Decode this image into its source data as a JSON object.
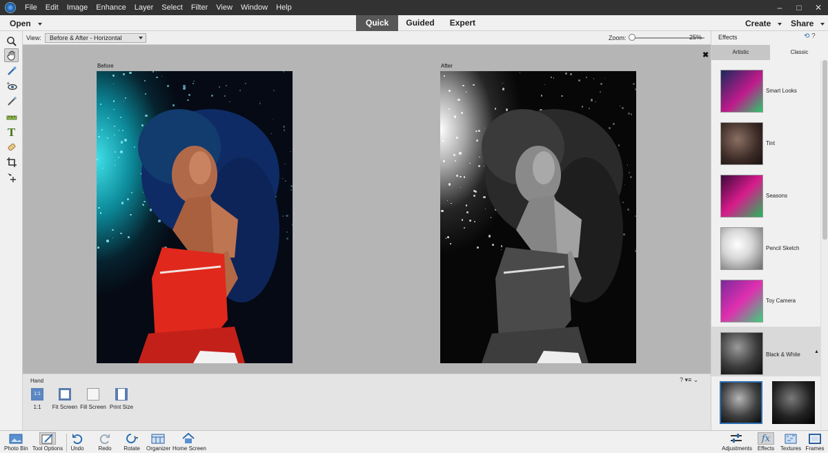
{
  "menubar": {
    "items": [
      "File",
      "Edit",
      "Image",
      "Enhance",
      "Layer",
      "Select",
      "Filter",
      "View",
      "Window",
      "Help"
    ],
    "window_controls": [
      "–",
      "□",
      "✕"
    ]
  },
  "modebar": {
    "open_label": "Open",
    "modes": [
      "Quick",
      "Guided",
      "Expert"
    ],
    "active_mode": "Quick",
    "create_label": "Create",
    "share_label": "Share"
  },
  "options": {
    "view_label": "View:",
    "view_value": "Before & After - Horizontal",
    "zoom_label": "Zoom:",
    "zoom_value": "25%",
    "zoom_fraction": 0.0
  },
  "canvas": {
    "before_label": "Before",
    "after_label": "After",
    "close_label": "✖"
  },
  "tool_options": {
    "tool_name": "Hand",
    "buttons": [
      "1:1",
      "Fit Screen",
      "Fill Screen",
      "Print Size"
    ],
    "one_to_one_icon_text": "1:1"
  },
  "right_panel": {
    "title": "Effects",
    "tabs": [
      "Artistic",
      "Classic"
    ],
    "active_tab": "Classic",
    "effects": [
      "Smart Looks",
      "Tint",
      "Seasons",
      "Pencil Sketch",
      "Toy Camera",
      "Black & White"
    ],
    "selected_effect": "Black & White"
  },
  "bottombar": {
    "left": [
      "Photo Bin",
      "Tool Options",
      "Undo",
      "Redo",
      "Rotate",
      "Organizer",
      "Home Screen"
    ],
    "right": [
      "Adjustments",
      "Effects",
      "Textures",
      "Frames"
    ]
  },
  "colors": {
    "menubar_bg": "#323232",
    "active_mode_bg": "#575757",
    "accent": "#2b6fb3"
  }
}
